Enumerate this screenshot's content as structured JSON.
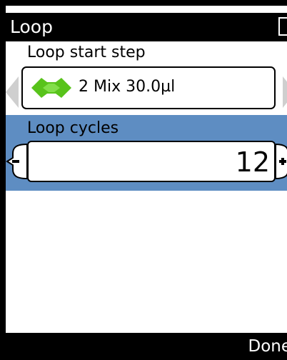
{
  "title_bar": {
    "title": "Loop"
  },
  "loop_start": {
    "label": "Loop start step",
    "step_text": "2  Mix 30.0µl",
    "icon": "mix-step-icon",
    "icon_color": "#58c31b"
  },
  "loop_cycles": {
    "label": "Loop cycles",
    "value": "12",
    "band_color": "#5e8dc2"
  },
  "bottom_bar": {
    "done_label": "Done"
  }
}
